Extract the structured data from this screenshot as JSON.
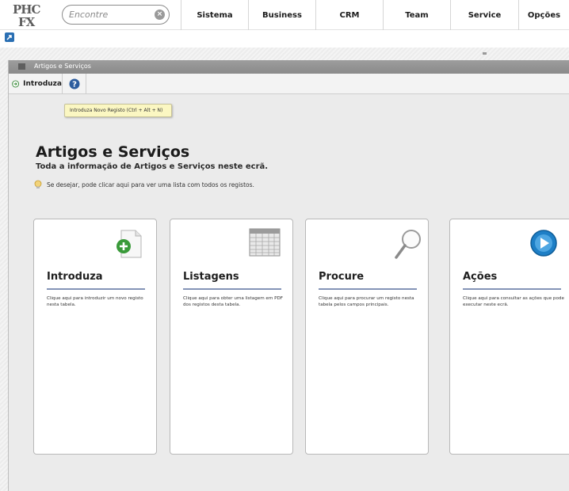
{
  "header": {
    "logo_text": "PHC FX",
    "search": {
      "placeholder": "Encontre",
      "value": ""
    },
    "nav": [
      {
        "label": "Sistema"
      },
      {
        "label": "Business"
      },
      {
        "label": "CRM"
      },
      {
        "label": "Team"
      },
      {
        "label": "Service"
      },
      {
        "label": "Opções"
      }
    ]
  },
  "window": {
    "title": "Artigos e Serviços",
    "toolbar": {
      "introduza_label": "Introduza",
      "help_icon": "help-icon"
    },
    "tooltip": "Introduza Novo Registo (Ctrl + Alt + N)",
    "heading": "Artigos e Serviços",
    "subheading": "Toda a informação de Artigos e Serviços neste ecrã.",
    "hint": "Se desejar, pode clicar aqui para ver uma lista com todos os registos."
  },
  "cards": [
    {
      "title": "Introduza",
      "description": "Clique aqui para introduzir um novo registo nesta tabela.",
      "icon": "new-document-icon"
    },
    {
      "title": "Listagens",
      "description": "Clique aqui para obter uma listagem em PDF dos registos desta tabela.",
      "icon": "spreadsheet-icon"
    },
    {
      "title": "Procure",
      "description": "Clique aqui para procurar um registo nesta tabela pelos campos principais.",
      "icon": "magnifier-icon"
    },
    {
      "title": "Ações",
      "description": "Clique aqui para consultar as ações que pode executar neste ecrã.",
      "icon": "play-icon"
    }
  ],
  "colors": {
    "accent_rule": "#8494b7",
    "title_bar": "#8f8f8f",
    "tooltip_bg": "#fbf7c2",
    "play_blue": "#1e7fc6",
    "add_green": "#3a9a3a"
  }
}
